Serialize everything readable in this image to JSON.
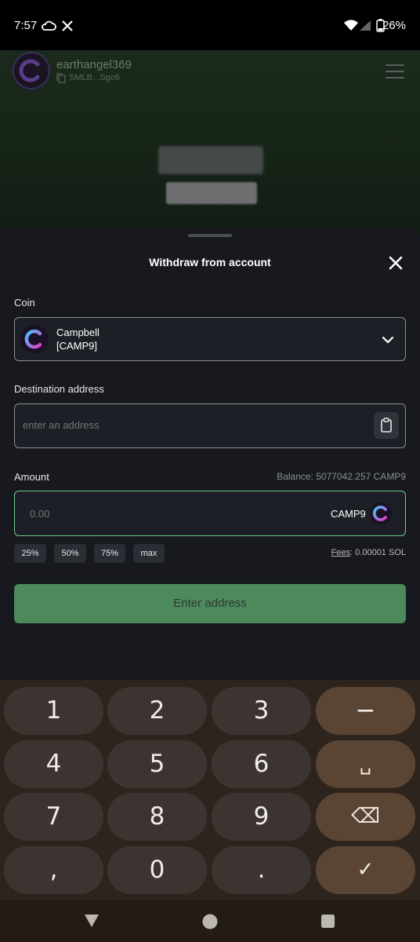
{
  "status_bar": {
    "time": "7:57",
    "battery": "26%"
  },
  "background_app": {
    "user_name": "earthangel369",
    "short_address": "SMLB...Sgo6"
  },
  "sheet": {
    "title": "Withdraw from account",
    "coin_label": "Coin",
    "coin": {
      "name": "Campbell",
      "ticker": "[CAMP9]"
    },
    "destination_label": "Destination address",
    "destination_placeholder": "enter an address",
    "amount_label": "Amount",
    "balance": "Balance: 5077042.257 CAMP9",
    "amount_placeholder": "0.00",
    "amount_ticker": "CAMP9",
    "percent_buttons": [
      "25%",
      "50%",
      "75%",
      "max"
    ],
    "fees_label": "Fees",
    "fees_value": ": 0.00001 SOL",
    "submit_label": "Enter address"
  },
  "keyboard": {
    "keys": [
      "1",
      "2",
      "3",
      "−",
      "4",
      "5",
      "6",
      "␣",
      "7",
      "8",
      "9",
      "⌫",
      ",",
      "0",
      ".",
      "✓"
    ]
  },
  "colors": {
    "accent_green": "#6fc98a",
    "button_green": "#4c8a5c",
    "sheet_bg": "#17191e"
  }
}
